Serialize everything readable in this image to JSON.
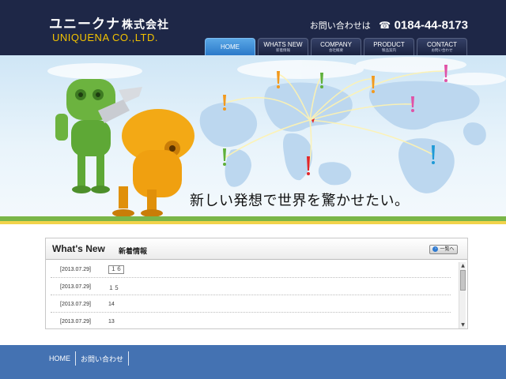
{
  "header": {
    "company_jp": "ユニークナ",
    "company_suffix": "株式会社",
    "company_en": "UNIQUENA CO.,LTD.",
    "contact_label": "お問い合わせは",
    "tel_icon": "☎",
    "tel": "0184-44-8173"
  },
  "nav": [
    {
      "label": "HOME",
      "sub": ""
    },
    {
      "label": "WHATS NEW",
      "sub": "新着情報"
    },
    {
      "label": "COMPANY",
      "sub": "会社概要"
    },
    {
      "label": "PRODUCT",
      "sub": "製品案内"
    },
    {
      "label": "CONTACT",
      "sub": "お問い合わせ"
    }
  ],
  "hero": {
    "caption": "新しい発想で世界を驚かせたい。"
  },
  "news": {
    "title": "What's New",
    "subtitle": "新着情報",
    "list_button": "一覧へ",
    "items": [
      {
        "date": "[2013.07.29]",
        "text": "１６"
      },
      {
        "date": "[2013.07.29]",
        "text": "１５"
      },
      {
        "date": "[2013.07.29]",
        "text": "14"
      },
      {
        "date": "[2013.07.29]",
        "text": "13"
      }
    ]
  },
  "footer": {
    "links": [
      "HOME",
      "お問い合わせ"
    ]
  },
  "colors": {
    "header_bg": "#1e2747",
    "accent_yellow": "#f2c200",
    "active_tab": "#2a79c9",
    "footer_bg": "#4472b2",
    "stripe_green": "#7ab648",
    "stripe_yellow": "#f2d34b"
  },
  "icons": {
    "tel": "phone-icon",
    "list_arrow": "circle-arrow-icon"
  }
}
